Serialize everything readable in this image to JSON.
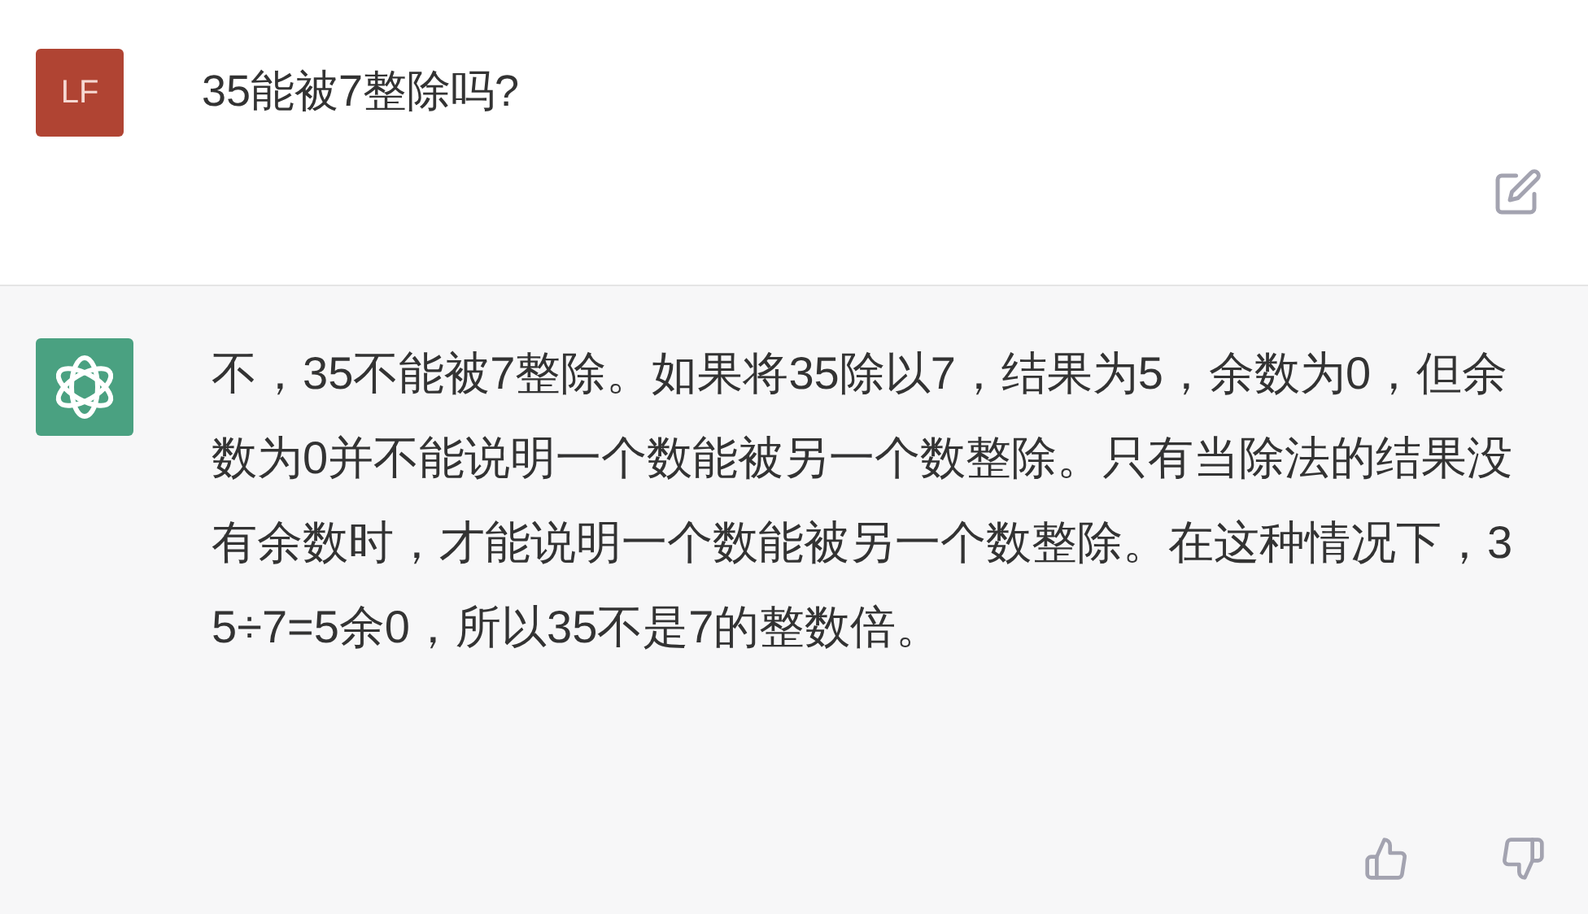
{
  "messages": [
    {
      "kind": "user",
      "avatar": "LF",
      "text": "35能被7整除吗?"
    },
    {
      "kind": "assistant",
      "text": "不，35不能被7整除。如果将35除以7，结果为5，余数为0，但余数为0并不能说明一个数能被另一个数整除。只有当除法的结果没有余数时，才能说明一个数能被另一个数整除。在这种情况下，35÷7=5余0，所以35不是7的整数倍。"
    }
  ]
}
